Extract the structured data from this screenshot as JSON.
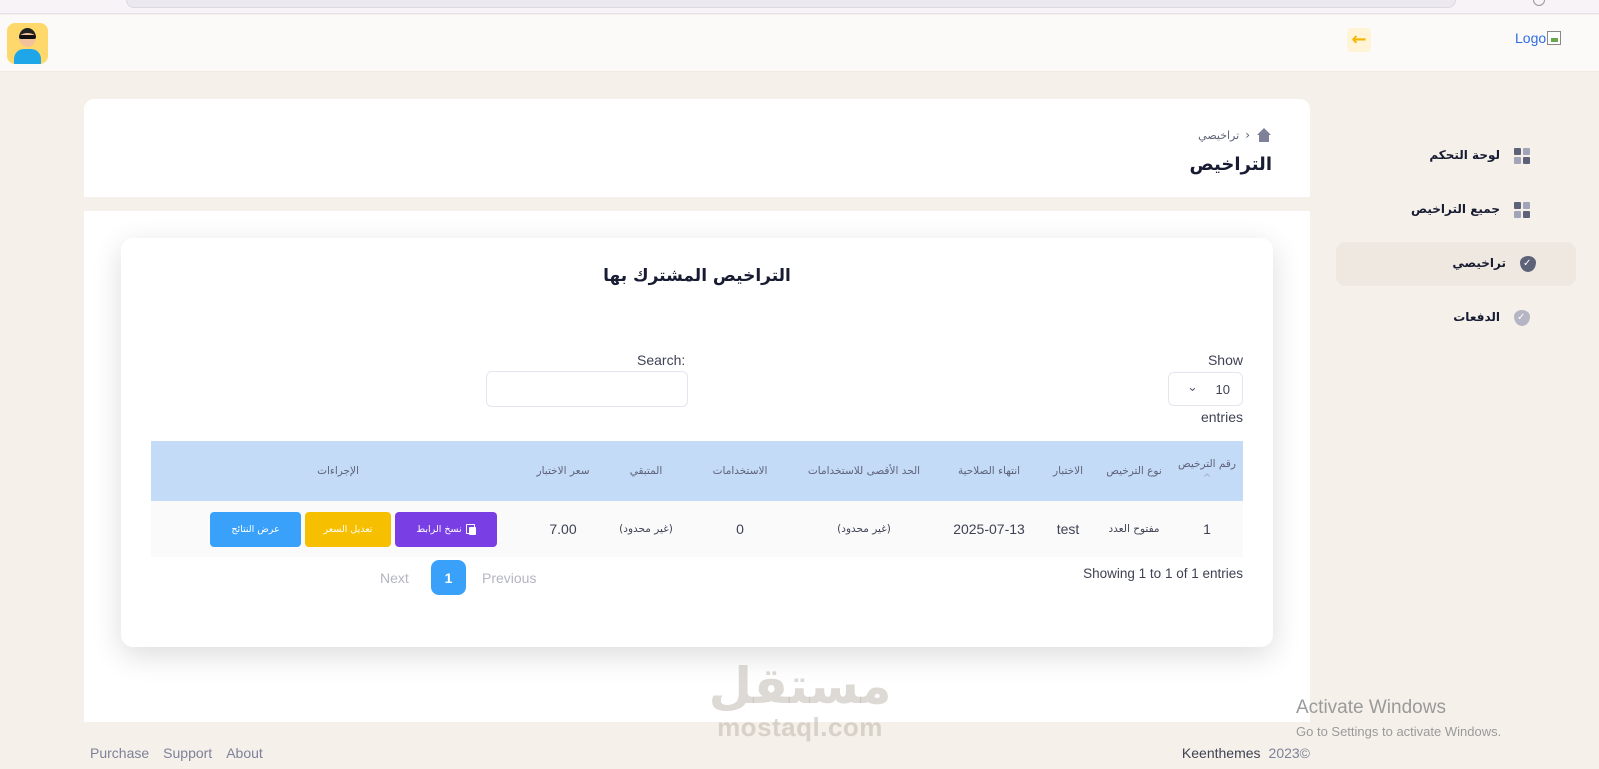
{
  "topbar": {
    "logo_text": "Logo",
    "logout_icon": "arrow-left-icon"
  },
  "sidebar": {
    "items": [
      {
        "label": "لوحة التحكم",
        "icon": "grid-icon",
        "active": false
      },
      {
        "label": "جميع التراخيص",
        "icon": "grid-icon",
        "active": false
      },
      {
        "label": "تراخيصي",
        "icon": "shield-check-icon",
        "active": true
      },
      {
        "label": "الدفعات",
        "icon": "shield-check-icon",
        "active": false
      }
    ]
  },
  "page": {
    "breadcrumb": "تراخيصي",
    "title": "التراخيص"
  },
  "table_card": {
    "title": "التراخيص المشترك بها",
    "show_label": "Show",
    "page_length": "10",
    "entries_label": "entries",
    "search_label": "Search:",
    "search_placeholder": "",
    "columns": [
      "رقم الترخيص",
      "نوع الترخيص",
      "الاختبار",
      "انتهاء الصلاحية",
      "الحد الأقصى للاستخدامات",
      "الاستخدامات",
      "المتبقي",
      "سعر الاختبار",
      "الإجراءات"
    ],
    "sort_indicator": "^",
    "rows": [
      {
        "license_no": "1",
        "license_type": "مفتوح العدد",
        "test": "test",
        "expiry": "2025-07-13",
        "max_uses": "(غير محدود)",
        "uses": "0",
        "remaining": "(غير محدود)",
        "price": "7.00",
        "actions": {
          "copy_link": "نسخ الرابط",
          "edit_price": "تعديل السعر",
          "view_results": "عرض النتائج"
        }
      }
    ],
    "showing_text": "Showing 1 to 1 of 1 entries",
    "pagination": {
      "previous": "Previous",
      "current_page": "1",
      "next": "Next"
    }
  },
  "footer": {
    "links": [
      "Purchase",
      "Support",
      "About"
    ],
    "copyright_year": "2023©",
    "brand": "Keenthemes"
  },
  "watermark": {
    "arabic": "مستقل",
    "latin": "mostaql.com"
  },
  "os_overlay": {
    "line1": "Activate Windows",
    "line2": "Go to Settings to activate Windows."
  },
  "colors": {
    "accent_blue": "#3aa1fb",
    "copy_purple": "#7a3fe4",
    "edit_yellow": "#f6c000",
    "table_header": "#c4dbf8",
    "page_bg": "#f5f0ea"
  }
}
